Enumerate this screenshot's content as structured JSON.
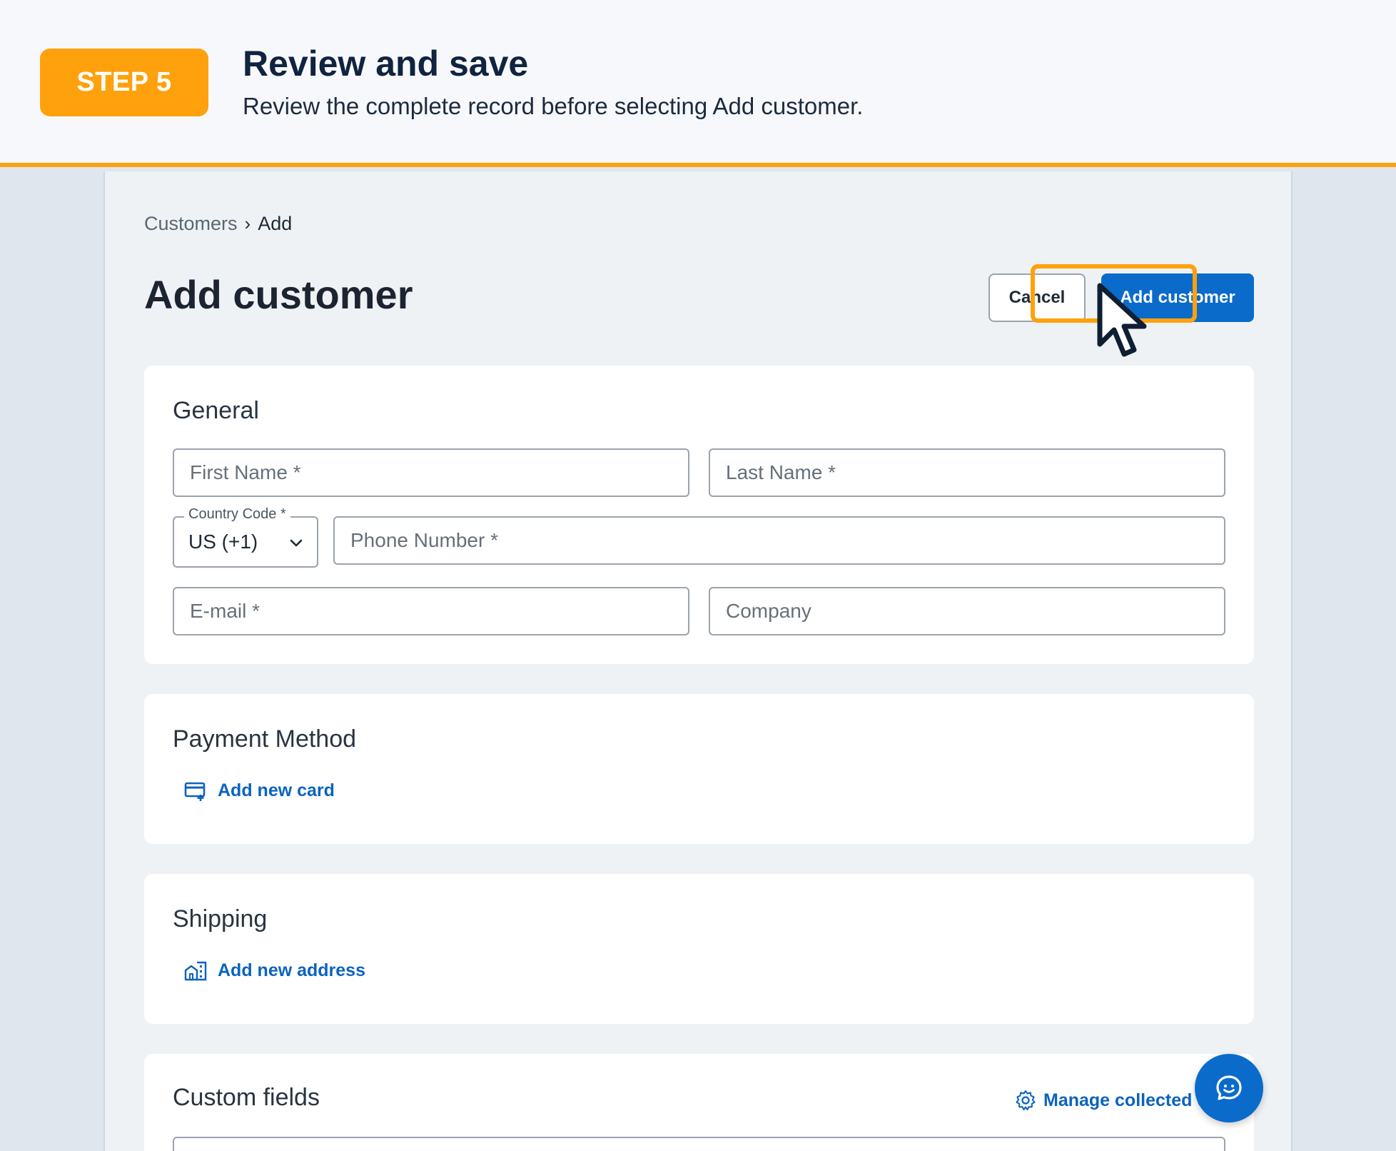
{
  "banner": {
    "step_label": "STEP 5",
    "title": "Review and save",
    "subtitle": "Review the complete record before selecting Add customer."
  },
  "breadcrumb": {
    "parent": "Customers",
    "separator": "›",
    "current": "Add"
  },
  "page_title": "Add customer",
  "actions": {
    "cancel_label": "Cancel",
    "add_label": "Add customer"
  },
  "general": {
    "title": "General",
    "first_name_placeholder": "First Name *",
    "last_name_placeholder": "Last Name *",
    "country_code_label": "Country Code *",
    "country_code_value": "US (+1)",
    "phone_placeholder": "Phone Number *",
    "email_placeholder": "E-mail *",
    "company_placeholder": "Company"
  },
  "payment": {
    "title": "Payment Method",
    "add_card_label": "Add new card",
    "icon": "credit-card-add-icon"
  },
  "shipping": {
    "title": "Shipping",
    "add_address_label": "Add new address",
    "icon": "building-address-icon"
  },
  "custom_fields": {
    "title": "Custom fields",
    "manage_label": "Manage collected d",
    "icon": "gear-icon"
  },
  "colors": {
    "accent_orange": "#ffa10c",
    "primary_blue": "#0b6bcb",
    "link_blue": "#0b63bf"
  }
}
